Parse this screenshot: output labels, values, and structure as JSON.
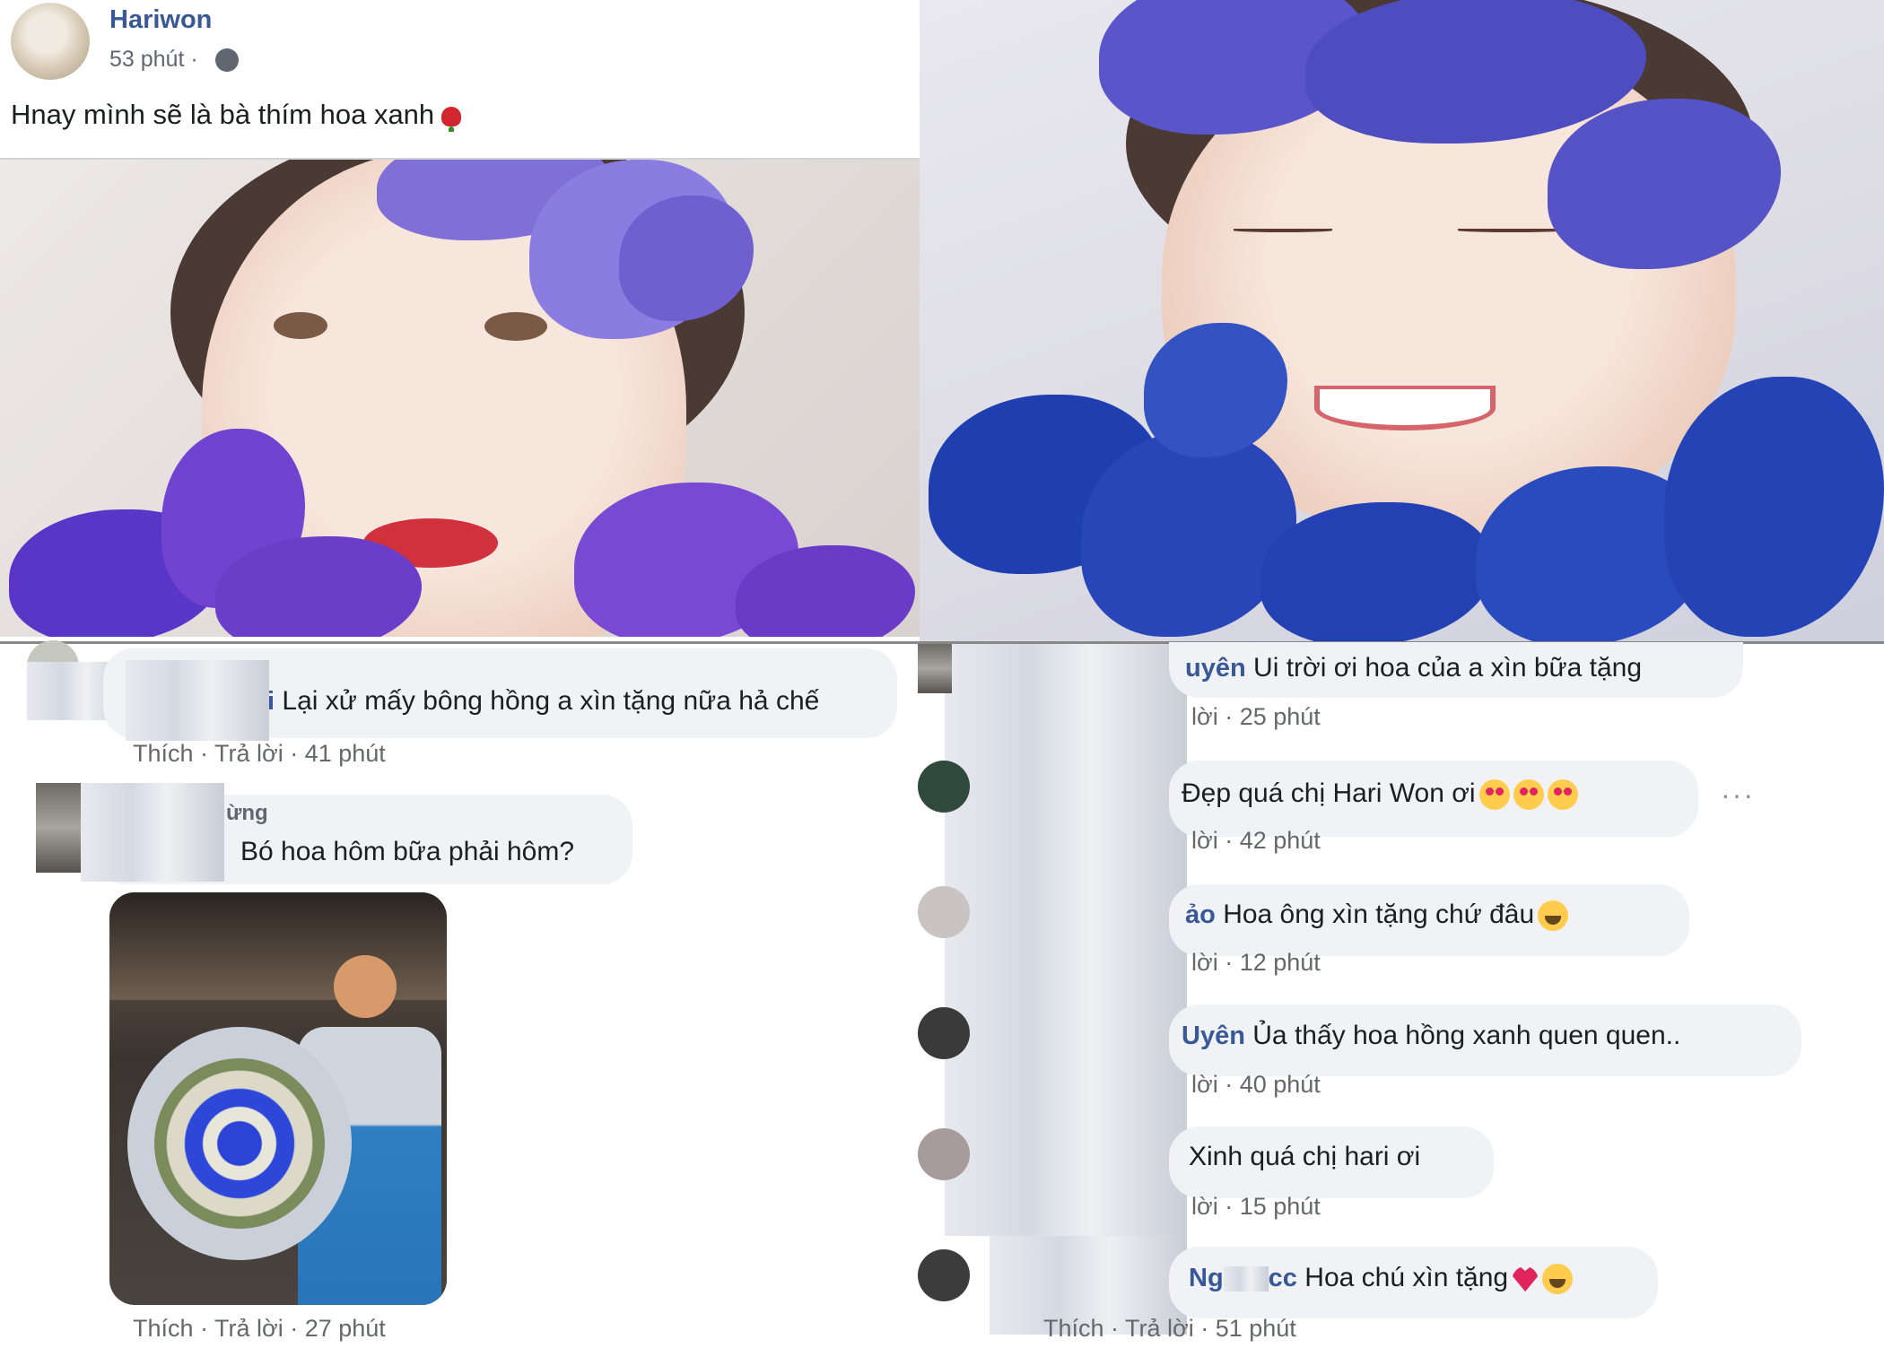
{
  "post": {
    "author": "Hariwon",
    "time": "53 phút ·",
    "privacy_icon": "globe-icon",
    "text": "Hnay mình sẽ là bà thím hoa xanh",
    "emoji_icon": "rose-icon"
  },
  "left_comments": [
    {
      "name_fragment": "i",
      "text": "Lại xử mấy bông hồng a xìn tặng nữa hả chế",
      "actions": "Thích · Trả lời · 41 phút"
    },
    {
      "name_fragment": "ừng",
      "text": "Bó hoa hôm bữa phải hôm?",
      "actions": "Thích · Trả lời · 27 phút"
    }
  ],
  "right_comments": [
    {
      "name_fragment": "uyên",
      "text": "Ui trời ơi hoa của a xìn bữa tặng",
      "actions": "lời · 25 phút",
      "emoji": ""
    },
    {
      "name_fragment": "",
      "text": "Đẹp quá chị Hari Won ơi",
      "actions": "lời · 42 phút",
      "emoji": "heart-eyes-icon",
      "more": "···"
    },
    {
      "name_fragment": "ảo",
      "text": "Hoa ông xìn tặng chứ đâu",
      "actions": "lời · 12 phút",
      "emoji": "rolling-laughing-icon"
    },
    {
      "name_fragment": "Uyên",
      "text": "Ủa thấy hoa hồng xanh quen quen..",
      "actions": "lời · 40 phút",
      "emoji": ""
    },
    {
      "name_fragment": "",
      "text": "Xinh quá chị hari ơi",
      "actions": "lời · 15 phút",
      "emoji": ""
    },
    {
      "name_fragment": "Ng",
      "name_fragment2": "cc",
      "text": "Hoa chú xìn tặng",
      "actions": "Thích · Trả lời · 51 phút",
      "emoji": "heart-icon"
    }
  ]
}
